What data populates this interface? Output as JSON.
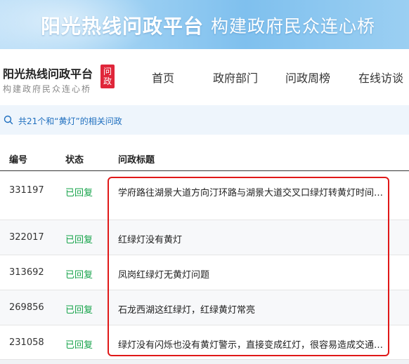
{
  "banner": {
    "title": "阳光热线问政平台",
    "slogan": "构建政府民众连心桥"
  },
  "logo": {
    "name": "阳光热线问政平台",
    "sub": "构建政府民众连心桥",
    "badge": "问政"
  },
  "nav": {
    "items": [
      "首页",
      "政府部门",
      "问政周榜",
      "在线访谈"
    ]
  },
  "search": {
    "summary": "共21个和“黄灯”的相关问政",
    "icon": "search-icon"
  },
  "table": {
    "headers": [
      "编号",
      "状态",
      "问政标题"
    ],
    "rows": [
      {
        "id": "331197",
        "status": "已回复",
        "title": "学府路往湖景大道方向汀环路与湖景大道交叉口绿灯转黄灯时间太短"
      },
      {
        "id": "322017",
        "status": "已回复",
        "title": "红绿灯没有黄灯"
      },
      {
        "id": "313692",
        "status": "已回复",
        "title": "凤岗红绿灯无黄灯问题"
      },
      {
        "id": "269856",
        "status": "已回复",
        "title": "石龙西湖这红绿灯，红绿黄灯常亮"
      },
      {
        "id": "231058",
        "status": "已回复",
        "title": "绿灯没有闪烁也没有黄灯警示，直接变成红灯，很容易造成交通事故"
      }
    ]
  },
  "colors": {
    "status_green": "#16a34a",
    "highlight_red": "#e01818",
    "badge_red": "#e0263a",
    "link_blue": "#1f6fbf"
  }
}
